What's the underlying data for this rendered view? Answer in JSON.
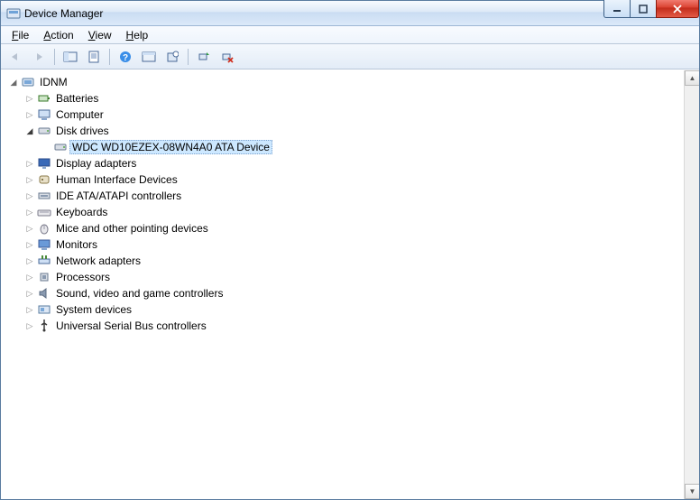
{
  "window": {
    "title": "Device Manager"
  },
  "menubar": {
    "file": "File",
    "action": "Action",
    "view": "View",
    "help": "Help"
  },
  "tree": {
    "root": "IDNM",
    "categories": [
      {
        "label": "Batteries",
        "icon": "battery"
      },
      {
        "label": "Computer",
        "icon": "computer"
      },
      {
        "label": "Disk drives",
        "icon": "disk",
        "expanded": true,
        "children": [
          {
            "label": "WDC WD10EZEX-08WN4A0 ATA Device",
            "icon": "disk",
            "selected": true
          }
        ]
      },
      {
        "label": "Display adapters",
        "icon": "display"
      },
      {
        "label": "Human Interface Devices",
        "icon": "hid"
      },
      {
        "label": "IDE ATA/ATAPI controllers",
        "icon": "ide"
      },
      {
        "label": "Keyboards",
        "icon": "keyboard"
      },
      {
        "label": "Mice and other pointing devices",
        "icon": "mouse"
      },
      {
        "label": "Monitors",
        "icon": "monitor"
      },
      {
        "label": "Network adapters",
        "icon": "network"
      },
      {
        "label": "Processors",
        "icon": "cpu"
      },
      {
        "label": "Sound, video and game controllers",
        "icon": "sound"
      },
      {
        "label": "System devices",
        "icon": "system"
      },
      {
        "label": "Universal Serial Bus controllers",
        "icon": "usb"
      }
    ]
  }
}
